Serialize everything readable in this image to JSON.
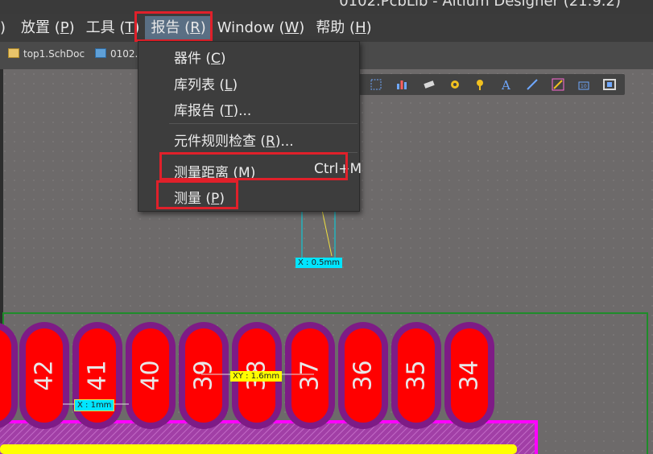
{
  "window": {
    "title": "0102.PcbLib - Altium Designer (21.9.2)"
  },
  "menubar": {
    "items": [
      {
        "label": ")"
      },
      {
        "label": "放置 (",
        "key": "P",
        "tail": ")"
      },
      {
        "label": "工具 (",
        "key": "T",
        "tail": ")"
      },
      {
        "label": "报告 (",
        "key": "R",
        "tail": ")"
      },
      {
        "label": "Window (",
        "key": "W",
        "tail": ")"
      },
      {
        "label": "帮助 (",
        "key": "H",
        "tail": ")"
      }
    ]
  },
  "tabs": [
    {
      "label": "top1.SchDoc"
    },
    {
      "label": "0102."
    }
  ],
  "report_menu": {
    "items": [
      {
        "label": "器件 (",
        "key": "C",
        "tail": ")"
      },
      {
        "label": "库列表 (",
        "key": "L",
        "tail": ")"
      },
      {
        "label": "库报告 (",
        "key": "T",
        "tail": ")..."
      },
      {
        "label": "元件规则检查 (",
        "key": "R",
        "tail": ")..."
      },
      {
        "label": "测量距离 (",
        "key": "M",
        "tail": ")",
        "shortcut": "Ctrl+M"
      },
      {
        "label": "测量 (",
        "key": "P",
        "tail": ")"
      }
    ]
  },
  "pcb": {
    "pads": [
      "42",
      "41",
      "40",
      "39",
      "38",
      "37",
      "36",
      "35",
      "34"
    ],
    "measurements": [
      {
        "text": "X : 0.5mm",
        "color": "#00e5ff"
      },
      {
        "text": "XY : 1.6mm",
        "color": "#ffff00"
      },
      {
        "text": "X : 1mm",
        "color": "#00e5ff"
      }
    ]
  },
  "colors": {
    "pad_fill": "#ff0000",
    "pad_outline": "#7e1b86",
    "menu_highlight": "#5a6f84",
    "annotation_box": "#e0202a",
    "board_outline": "#1e8c2a",
    "overlay": "#ff00ff"
  }
}
